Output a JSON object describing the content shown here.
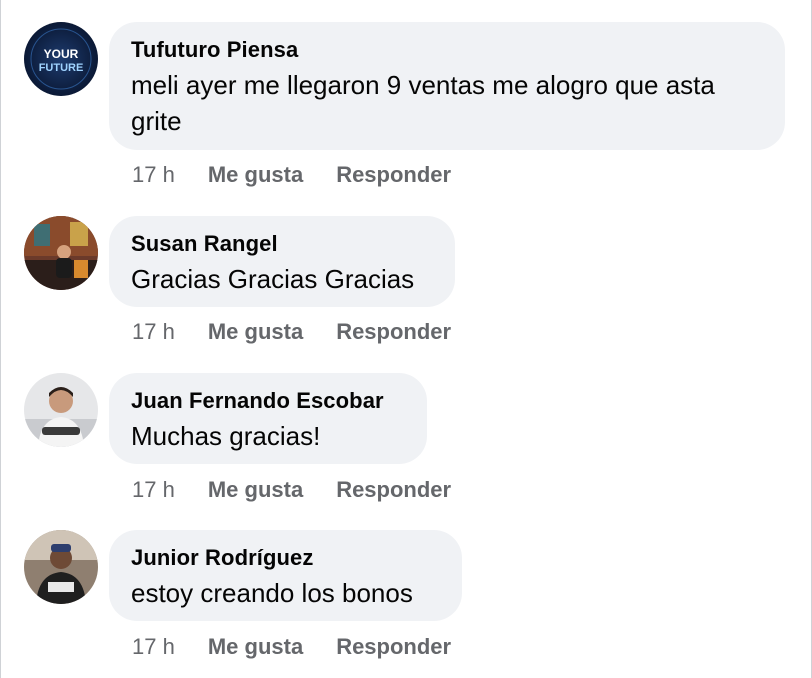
{
  "comments": [
    {
      "author": "Tufuturo Piensa",
      "text": "meli ayer me llegaron 9 ventas me alogro que asta grite",
      "time": "17 h",
      "like_label": "Me gusta",
      "reply_label": "Responder",
      "avatar_logo_text": [
        "YOUR",
        "FUTURE"
      ]
    },
    {
      "author": "Susan Rangel",
      "text": "Gracias Gracias Gracias",
      "time": "17 h",
      "like_label": "Me gusta",
      "reply_label": "Responder"
    },
    {
      "author": "Juan Fernando Escobar",
      "text": "Muchas gracias!",
      "time": "17 h",
      "like_label": "Me gusta",
      "reply_label": "Responder"
    },
    {
      "author": "Junior Rodríguez",
      "text": "estoy creando los bonos",
      "time": "17 h",
      "like_label": "Me gusta",
      "reply_label": "Responder"
    }
  ],
  "colors": {
    "bubble": "#f0f2f5",
    "secondary_text": "#65676b",
    "primary_text": "#050505"
  }
}
